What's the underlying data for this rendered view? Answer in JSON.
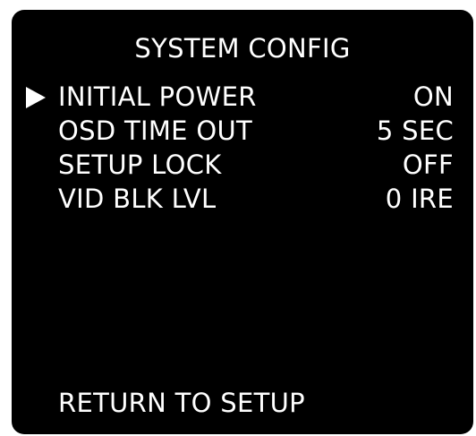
{
  "title": "SYSTEM CONFIG",
  "cursor_icon": "right-triangle-icon",
  "items": [
    {
      "label": "INITIAL POWER",
      "value": "ON"
    },
    {
      "label": "OSD TIME OUT",
      "value": "5 SEC"
    },
    {
      "label": "SETUP LOCK",
      "value": "OFF"
    },
    {
      "label": "VID BLK LVL",
      "value": "0 IRE"
    }
  ],
  "return_label": "RETURN TO SETUP",
  "colors": {
    "background": "#000000",
    "text": "#ffffff"
  }
}
